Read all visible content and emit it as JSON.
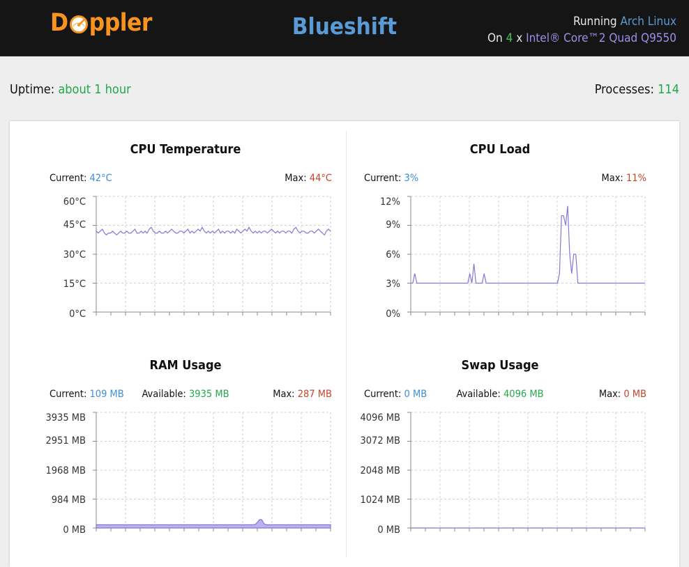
{
  "header": {
    "logo_left": "D",
    "logo_right": "ppler",
    "logo_icon": "gauge-icon",
    "hostname": "Blueshift",
    "running_prefix": "Running",
    "os": "Arch Linux",
    "on_prefix": "On",
    "cpu_count": "4",
    "times": "x",
    "cpu_model": "Intel® Core™2 Quad Q9550"
  },
  "status": {
    "uptime_label": "Uptime:",
    "uptime_value": "about 1 hour",
    "processes_label": "Processes:",
    "processes_value": "114"
  },
  "graphs": {
    "cpu_temp": {
      "title": "CPU Temperature",
      "current_label": "Current:",
      "current_value": "42°C",
      "max_label": "Max:",
      "max_value": "44°C",
      "y_ticks": [
        "60°C",
        "45°C",
        "30°C",
        "15°C",
        "0°C"
      ]
    },
    "cpu_load": {
      "title": "CPU Load",
      "current_label": "Current:",
      "current_value": "3%",
      "max_label": "Max:",
      "max_value": "11%",
      "y_ticks": [
        "12%",
        "9%",
        "6%",
        "3%",
        "0%"
      ]
    },
    "ram": {
      "title": "RAM Usage",
      "current_label": "Current:",
      "current_value": "109 MB",
      "available_label": "Available:",
      "available_value": "3935 MB",
      "max_label": "Max:",
      "max_value": "287 MB",
      "y_ticks": [
        "3935 MB",
        "2951 MB",
        "1968 MB",
        "984 MB",
        "0 MB"
      ]
    },
    "swap": {
      "title": "Swap Usage",
      "current_label": "Current:",
      "current_value": "0 MB",
      "available_label": "Available:",
      "available_value": "4096 MB",
      "max_label": "Max:",
      "max_value": "0 MB",
      "y_ticks": [
        "4096 MB",
        "3072 MB",
        "2048 MB",
        "1024 MB",
        "0 MB"
      ]
    }
  },
  "chart_data": [
    {
      "type": "line",
      "title": "CPU Temperature",
      "xlabel": "",
      "ylabel": "",
      "ylim": [
        0,
        60
      ],
      "grid": true,
      "series": [
        {
          "values": [
            42,
            41,
            42,
            43,
            41,
            40,
            41,
            41,
            42,
            41,
            40,
            41,
            42,
            41,
            41,
            42,
            41,
            41,
            42,
            43,
            41,
            41,
            42,
            41,
            42,
            41,
            43,
            44,
            42,
            41,
            41,
            42,
            41,
            41,
            42,
            41,
            42,
            43,
            42,
            41,
            41,
            42,
            42,
            41,
            42,
            43,
            41,
            42,
            41,
            42,
            43,
            42,
            44,
            42,
            41,
            42,
            41,
            42,
            41,
            42,
            43,
            41,
            42,
            41,
            42,
            42,
            41,
            42,
            41,
            43,
            42,
            41,
            42,
            43,
            42,
            44,
            42,
            41,
            42,
            41,
            42,
            41,
            42,
            42,
            41,
            42,
            43,
            42,
            41,
            42,
            41,
            42,
            42,
            41,
            42,
            42,
            41,
            43,
            44,
            42,
            41,
            42,
            42,
            41,
            41,
            42,
            42,
            41,
            42,
            43,
            42,
            41,
            40,
            42,
            43,
            42
          ]
        }
      ]
    },
    {
      "type": "line",
      "title": "CPU Load",
      "xlabel": "",
      "ylabel": "",
      "ylim": [
        0,
        12
      ],
      "grid": true,
      "series": [
        {
          "values": [
            3,
            3,
            4,
            3,
            3,
            3,
            3,
            3,
            3,
            3,
            3,
            3,
            3,
            3,
            3,
            3,
            3,
            3,
            3,
            3,
            3,
            3,
            3,
            3,
            3,
            3,
            3,
            3,
            3,
            4,
            3,
            5,
            3,
            3,
            3,
            3,
            4,
            3,
            3,
            3,
            3,
            3,
            3,
            3,
            3,
            3,
            3,
            3,
            3,
            3,
            3,
            3,
            3,
            3,
            3,
            3,
            3,
            3,
            3,
            3,
            3,
            3,
            3,
            3,
            3,
            3,
            3,
            3,
            3,
            3,
            3,
            3,
            3,
            4,
            10,
            10,
            9,
            11,
            6,
            4,
            6,
            6,
            3,
            3,
            3,
            3,
            3,
            3,
            3,
            3,
            3,
            3,
            3,
            3,
            3,
            3,
            3,
            3,
            3,
            3,
            3,
            3,
            3,
            3,
            3,
            3,
            3,
            3,
            3,
            3,
            3,
            3,
            3,
            3,
            3,
            3
          ]
        }
      ]
    },
    {
      "type": "area",
      "title": "RAM Usage",
      "xlabel": "",
      "ylabel": "",
      "ylim": [
        0,
        3935
      ],
      "grid": true,
      "series": [
        {
          "values": [
            109,
            109,
            110,
            109,
            109,
            110,
            109,
            109,
            109,
            110,
            109,
            109,
            109,
            109,
            110,
            109,
            109,
            109,
            109,
            110,
            109,
            109,
            109,
            110,
            109,
            109,
            109,
            109,
            109,
            110,
            109,
            109,
            109,
            109,
            109,
            110,
            109,
            109,
            109,
            109,
            109,
            109,
            110,
            109,
            109,
            109,
            109,
            109,
            110,
            109,
            109,
            109,
            109,
            109,
            110,
            109,
            109,
            109,
            109,
            109,
            109,
            110,
            109,
            109,
            109,
            109,
            109,
            110,
            109,
            109,
            109,
            109,
            110,
            109,
            120,
            200,
            287,
            280,
            150,
            110,
            109,
            109,
            109,
            109,
            110,
            109,
            109,
            109,
            109,
            109,
            110,
            109,
            109,
            109,
            109,
            109,
            110,
            109,
            109,
            109,
            109,
            109,
            110,
            109,
            109,
            109,
            109,
            109,
            109,
            109
          ]
        }
      ]
    },
    {
      "type": "area",
      "title": "Swap Usage",
      "xlabel": "",
      "ylabel": "",
      "ylim": [
        0,
        4096
      ],
      "grid": true,
      "series": [
        {
          "values": [
            0,
            0,
            0,
            0,
            0,
            0,
            0,
            0,
            0,
            0,
            0,
            0,
            0,
            0,
            0,
            0,
            0,
            0,
            0,
            0,
            0,
            0,
            0,
            0,
            0,
            0,
            0,
            0,
            0,
            0,
            0,
            0,
            0,
            0,
            0,
            0,
            0,
            0,
            0,
            0,
            0,
            0,
            0,
            0,
            0,
            0,
            0,
            0,
            0,
            0,
            0,
            0,
            0,
            0,
            0,
            0,
            0,
            0,
            0,
            0,
            0,
            0,
            0,
            0,
            0,
            0,
            0,
            0,
            0,
            0,
            0,
            0,
            0,
            0,
            0,
            0,
            0,
            0,
            0,
            0,
            0,
            0,
            0,
            0,
            0,
            0,
            0,
            0,
            0,
            0,
            0,
            0,
            0,
            0,
            0,
            0,
            0,
            0,
            0,
            0
          ]
        }
      ]
    }
  ]
}
